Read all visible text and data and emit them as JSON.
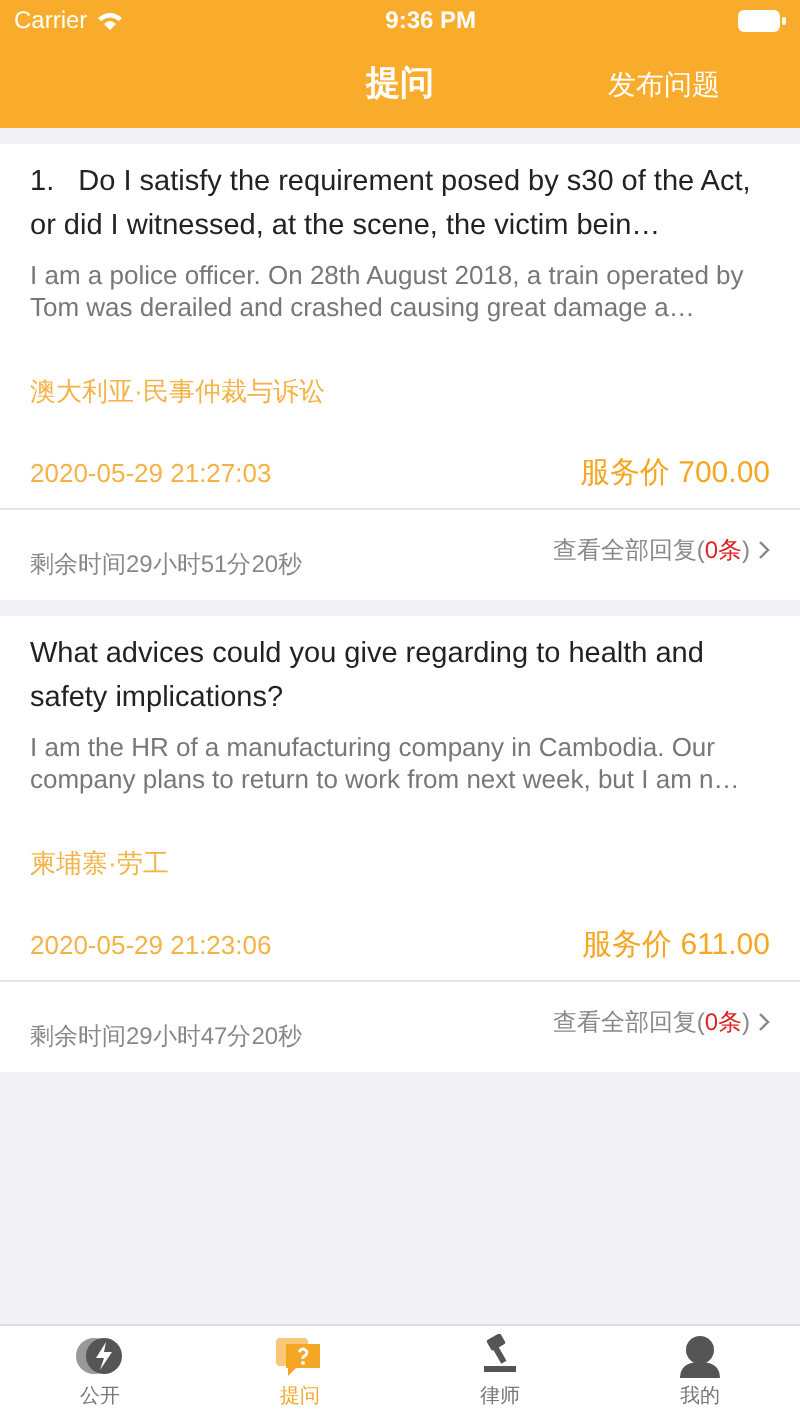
{
  "status_bar": {
    "carrier": "Carrier",
    "time": "9:36 PM"
  },
  "nav": {
    "title": "提问",
    "action": "发布问题"
  },
  "questions": [
    {
      "title": "1.   Do I satisfy the requirement posed by s30 of the Act, or did I witnessed, at the scene, the victim bein…",
      "body": "I am a police officer. On 28th August 2018, a train operated by Tom was derailed and crashed causing great damage a…",
      "category": "澳大利亚·民事仲裁与诉讼",
      "date": "2020-05-29 21:27:03",
      "price": "服务价 700.00",
      "remaining": "剩余时间29小时51分20秒",
      "replies_prefix": "查看全部回复(",
      "reply_count": "0条",
      "replies_suffix": ")"
    },
    {
      "title": "What advices could you give regarding to health and safety implications?",
      "body": "I am the HR of a manufacturing company in Cambodia. Our company plans to return to work from next week, but I am n…",
      "category": "柬埔寨·劳工",
      "date": "2020-05-29 21:23:06",
      "price": "服务价 611.00",
      "remaining": "剩余时间29小时47分20秒",
      "replies_prefix": "查看全部回复(",
      "reply_count": "0条",
      "replies_suffix": ")"
    }
  ],
  "tabs": [
    {
      "label": "公开",
      "kind": "bolt",
      "selected": false
    },
    {
      "label": "提问",
      "kind": "question",
      "selected": true
    },
    {
      "label": "律师",
      "kind": "gavel",
      "selected": false
    },
    {
      "label": "我的",
      "kind": "person",
      "selected": false
    }
  ]
}
